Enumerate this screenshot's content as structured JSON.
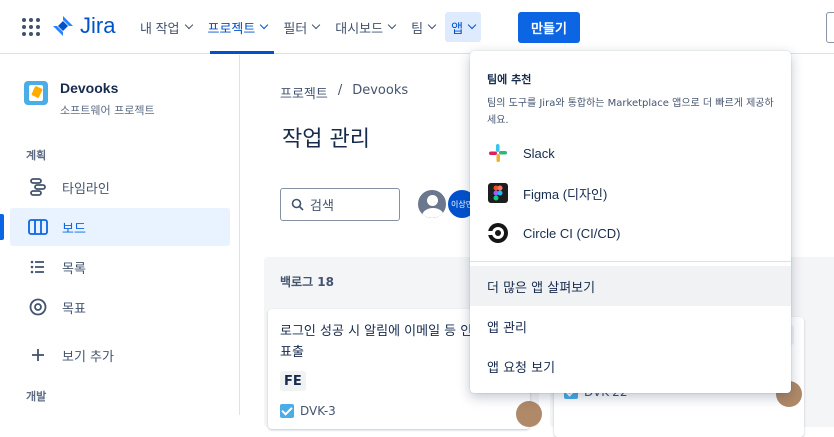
{
  "topbar": {
    "logo_text": "Jira",
    "nav": [
      {
        "label": "내 작업"
      },
      {
        "label": "프로젝트"
      },
      {
        "label": "필터"
      },
      {
        "label": "대시보드"
      },
      {
        "label": "팀"
      },
      {
        "label": "앱"
      }
    ],
    "create_label": "만들기",
    "accent": "#0c66e4"
  },
  "sidebar": {
    "project_name": "Devooks",
    "project_type": "소프트웨어 프로젝트",
    "section_plan": "계획",
    "section_dev": "개발",
    "items": [
      {
        "label": "타임라인",
        "icon": "timeline-icon"
      },
      {
        "label": "보드",
        "icon": "board-icon"
      },
      {
        "label": "목록",
        "icon": "list-icon"
      },
      {
        "label": "목표",
        "icon": "goal-icon"
      },
      {
        "label": "보기 추가",
        "icon": "plus-icon"
      }
    ]
  },
  "main": {
    "breadcrumb": [
      "프로젝트",
      "/",
      "Devooks"
    ],
    "title": "작업 관리",
    "search_placeholder": "검색",
    "avatar2_text": "이상민",
    "column_title": "백로그 18",
    "card": {
      "title": "로그인 성공 시 알림에 이메일 등 인증 알림 표출",
      "tag": "FE",
      "key": "DVK-3"
    },
    "card2_key": "DVK-22"
  },
  "apps_menu": {
    "heading": "팀에 추천",
    "description": "팀의 도구를 Jira와 통합하는 Marketplace 앱으로 더 빠르게 제공하세요.",
    "apps": [
      {
        "name": "Slack",
        "icon": "slack-icon"
      },
      {
        "name": "Figma (디자인)",
        "icon": "figma-icon"
      },
      {
        "name": "Circle CI (CI/CD)",
        "icon": "circleci-icon"
      }
    ],
    "links": [
      {
        "label": "더 많은 앱 살펴보기"
      },
      {
        "label": "앱 관리"
      },
      {
        "label": "앱 요청 보기"
      }
    ]
  }
}
